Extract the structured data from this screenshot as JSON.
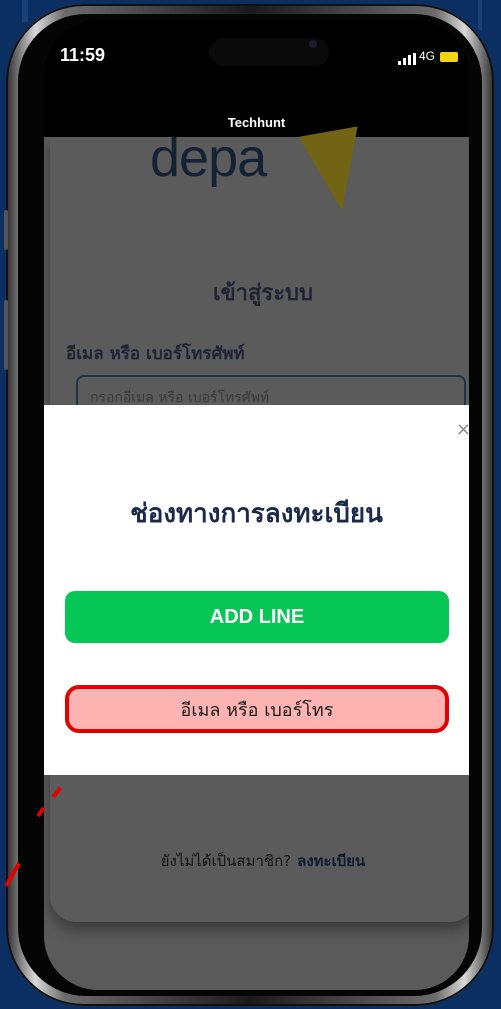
{
  "status_bar": {
    "time": "11:59",
    "network": "4G"
  },
  "app_bar": {
    "title": "Techhunt"
  },
  "login_page": {
    "logo_text": "depa",
    "title": "เข้าสู่ระบบ",
    "field_label": "อีเมล หรือ เบอร์โทรศัพท์",
    "field_placeholder": "กรอกอีเมล หรือ เบอร์โทรศัพท์",
    "signup_prompt": "ยังไม่ได้เป็นสมาชิก?",
    "signup_link": "ลงทะเบียน"
  },
  "modal": {
    "close_symbol": "×",
    "title": "ช่องทางการลงทะเบียน",
    "line_button": "ADD LINE",
    "email_button": "อีเมล หรือ เบอร์โทร"
  },
  "colors": {
    "background": "#0c2f63",
    "line_green": "#06c755",
    "highlight_red": "#e30000",
    "highlight_fill": "#ffb3b3"
  }
}
